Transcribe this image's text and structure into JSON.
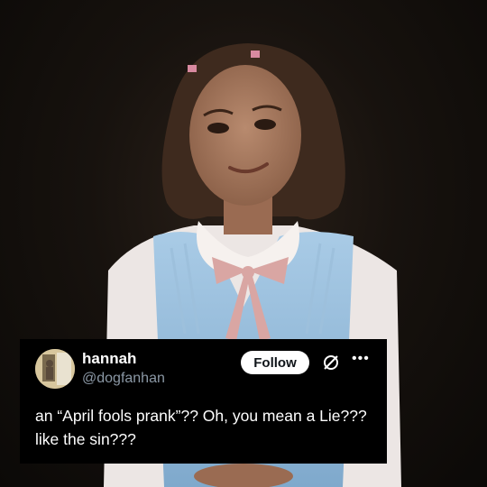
{
  "tweet": {
    "display_name": "hannah",
    "handle": "@dogfanhan",
    "follow_label": "Follow",
    "text": "an “April fools prank”?? Oh, you mean a Lie??? like the sin???",
    "grok_icon": "grok-icon",
    "more_icon": "more-icon"
  },
  "colors": {
    "card_background": "#000000",
    "follow_button": "#ffffff",
    "handle_text": "#8b98a5"
  }
}
